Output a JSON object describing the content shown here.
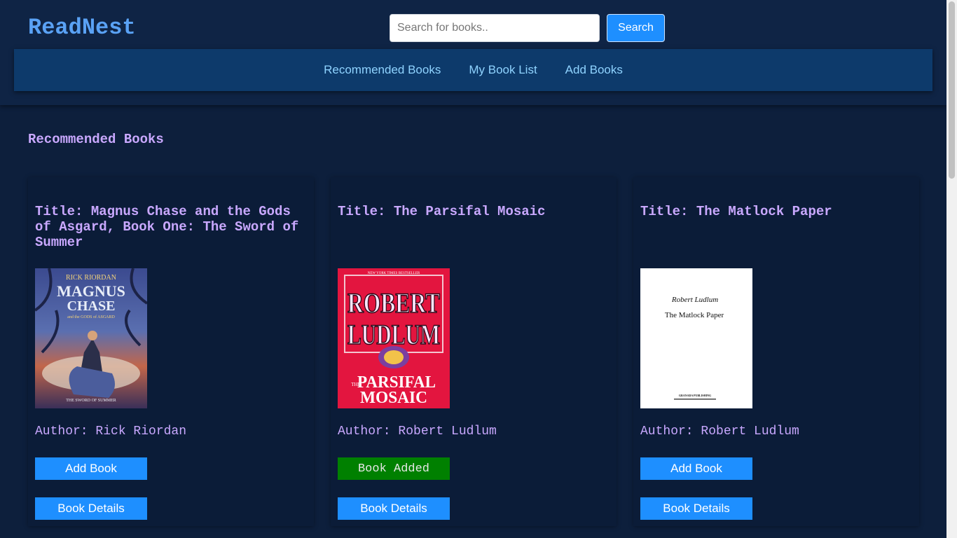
{
  "app": {
    "name": "ReadNest"
  },
  "search": {
    "placeholder": "Search for books..",
    "button_label": "Search"
  },
  "nav": {
    "items": [
      "Recommended Books",
      "My Book List",
      "Add Books"
    ]
  },
  "section": {
    "title": "Recommended Books"
  },
  "books": [
    {
      "title": "Title: Magnus Chase and the Gods of Asgard, Book One: The Sword of Summer",
      "author": "Author: Rick Riordan",
      "action_label": "Add Book",
      "details_label": "Book Details",
      "cover": {
        "author": "RICK RIORDAN",
        "line1": "MAGNUS",
        "line2": "CHASE",
        "line3": "and the GODS of ASGARD",
        "footer": "THE SWORD OF SUMMER"
      }
    },
    {
      "title": "Title: The Parsifal Mosaic",
      "author": "Author: Robert Ludlum",
      "action_label": "Book Added",
      "details_label": "Book Details",
      "cover": {
        "banner": "NEW YORK TIMES BESTSELLER",
        "line1": "ROBERT",
        "line2": "LUDLUM",
        "line3": "THE",
        "line4": "PARSIFAL",
        "line5": "MOSAIC"
      }
    },
    {
      "title": "Title: The Matlock Paper",
      "author": "Author: Robert Ludlum",
      "action_label": "Add Book",
      "details_label": "Book Details",
      "cover": {
        "author": "Robert Ludlum",
        "title": "The Matlock Paper",
        "publisher": "GRANADA PUBLISHING"
      }
    }
  ],
  "colors": {
    "accent": "#1e8fff",
    "added": "#008000",
    "heading": "#c9a8ff",
    "logo": "#5aa2f5",
    "nav_link": "#8fd3ff"
  }
}
